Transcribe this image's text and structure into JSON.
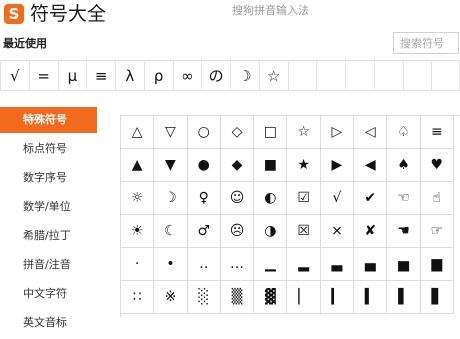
{
  "header": {
    "logo_glyph": "S",
    "title": "符号大全",
    "subtitle": "搜狗拼音输入法"
  },
  "recent": {
    "heading": "最近使用",
    "symbols": [
      "√",
      "=",
      "μ",
      "≡",
      "λ",
      "ρ",
      "∞",
      "の",
      "☽",
      "☆",
      "",
      "",
      "",
      "",
      "",
      ""
    ]
  },
  "search": {
    "placeholder": "搜索符号",
    "value": ""
  },
  "sidebar": {
    "items": [
      {
        "label": "特殊符号",
        "active": true
      },
      {
        "label": "标点符号",
        "active": false
      },
      {
        "label": "数字序号",
        "active": false
      },
      {
        "label": "数学/单位",
        "active": false
      },
      {
        "label": "希腊/拉丁",
        "active": false
      },
      {
        "label": "拼音/注音",
        "active": false
      },
      {
        "label": "中文字符",
        "active": false
      },
      {
        "label": "英文音标",
        "active": false
      }
    ]
  },
  "symbols_grid": {
    "rows": [
      [
        "△",
        "▽",
        "○",
        "◇",
        "□",
        "☆",
        "▷",
        "◁",
        "♤",
        "≡"
      ],
      [
        "▲",
        "▼",
        "●",
        "◆",
        "■",
        "★",
        "▶",
        "◀",
        "♠",
        "♥"
      ],
      [
        "☼",
        "☽",
        "♀",
        "☺",
        "◐",
        "☑",
        "√",
        "✔",
        "☜",
        "☝"
      ],
      [
        "☀",
        "☾",
        "♂",
        "☹",
        "◑",
        "☒",
        "×",
        "✘",
        "☚",
        "☞"
      ],
      [
        "·",
        "•",
        "‥",
        "…",
        "▁",
        "▂",
        "▃",
        "▄",
        "▅",
        "▆"
      ],
      [
        "∷",
        "※",
        "░",
        "▒",
        "▓",
        "▏",
        "▎",
        "▍",
        "▌",
        "▋"
      ]
    ]
  },
  "colors": {
    "accent": "#f26b1d",
    "grid_border": "#dcdcdc",
    "muted_text": "#999999"
  }
}
